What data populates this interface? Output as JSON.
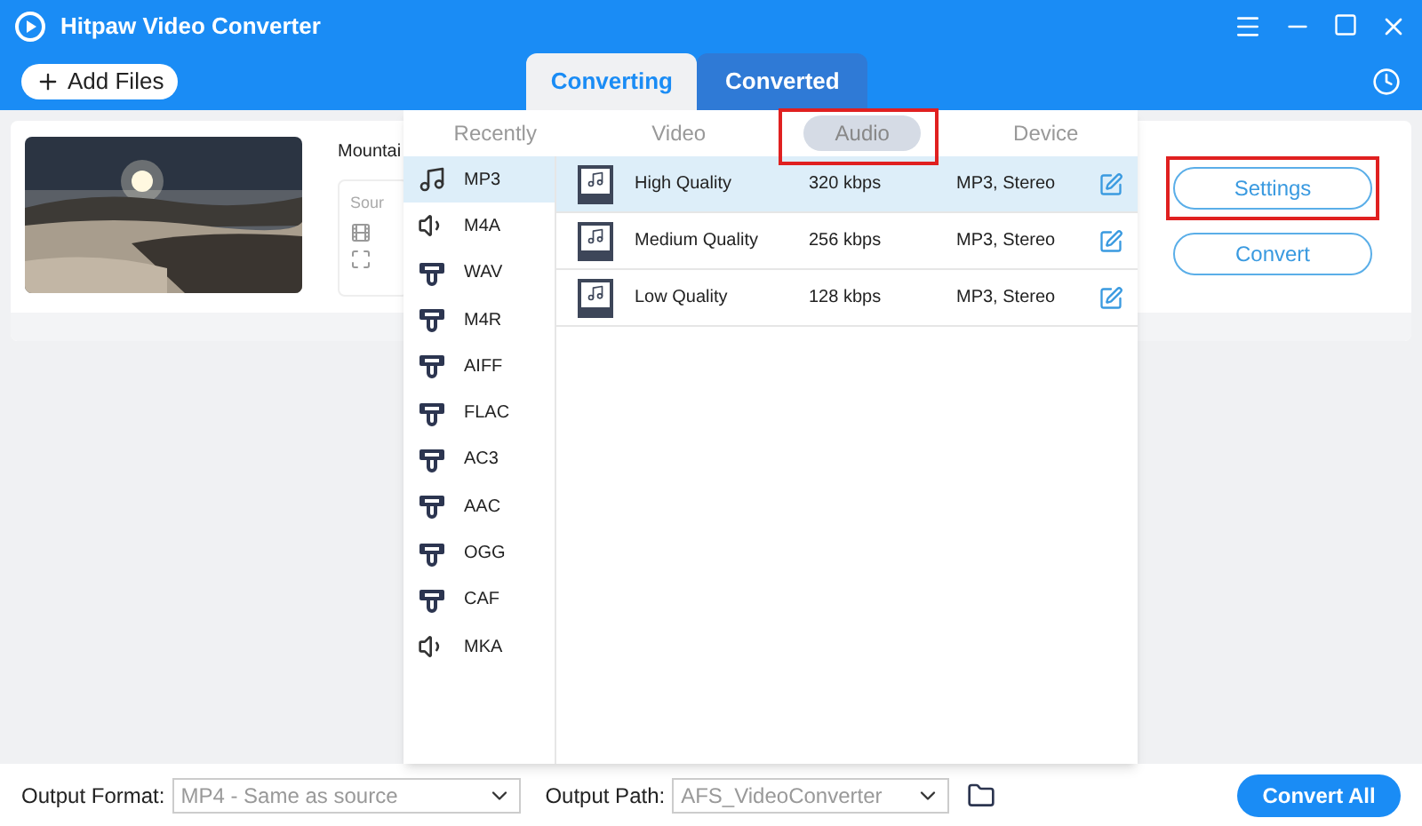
{
  "window": {
    "title": "Hitpaw Video Converter"
  },
  "toolbar": {
    "add_button": "Add Files"
  },
  "tabs": [
    {
      "label": "Converting",
      "selected": true
    },
    {
      "label": "Converted",
      "selected": false
    }
  ],
  "file_card": {
    "title": "Mountai",
    "source_label": "Sour",
    "buttons": [
      {
        "label": "Settings",
        "highlighted": true
      },
      {
        "label": "Convert",
        "highlighted": false
      }
    ]
  },
  "format_menu": {
    "categories": [
      {
        "label": "Recently",
        "selected": false,
        "highlighted": false
      },
      {
        "label": "Video",
        "selected": false,
        "highlighted": false
      },
      {
        "label": "Audio",
        "selected": true,
        "highlighted": true
      },
      {
        "label": "Device",
        "selected": false,
        "highlighted": false
      }
    ],
    "formats": [
      {
        "label": "MP3",
        "kind": "music",
        "selected": true
      },
      {
        "label": "M4A",
        "kind": "speaker",
        "selected": false
      },
      {
        "label": "WAV",
        "kind": "device",
        "selected": false
      },
      {
        "label": "M4R",
        "kind": "device",
        "selected": false
      },
      {
        "label": "AIFF",
        "kind": "device",
        "selected": false
      },
      {
        "label": "FLAC",
        "kind": "device",
        "selected": false
      },
      {
        "label": "AC3",
        "kind": "device",
        "selected": false
      },
      {
        "label": "AAC",
        "kind": "device",
        "selected": false
      },
      {
        "label": "OGG",
        "kind": "device",
        "selected": false
      },
      {
        "label": "CAF",
        "kind": "device",
        "selected": false
      },
      {
        "label": "MKA",
        "kind": "speaker",
        "selected": false
      }
    ],
    "qualities": [
      {
        "name": "High Quality",
        "bitrate": "320 kbps",
        "details": "MP3, Stereo",
        "selected": true
      },
      {
        "name": "Medium Quality",
        "bitrate": "256 kbps",
        "details": "MP3, Stereo",
        "selected": false
      },
      {
        "name": "Low Quality",
        "bitrate": "128 kbps",
        "details": "MP3, Stereo",
        "selected": false
      }
    ]
  },
  "bottom_bar": {
    "format_label": "Output Format:",
    "format_value": "MP4 - Same as source",
    "path_label": "Output Path:",
    "path_value": "AFS_VideoConverter",
    "convert_all": "Convert All"
  }
}
